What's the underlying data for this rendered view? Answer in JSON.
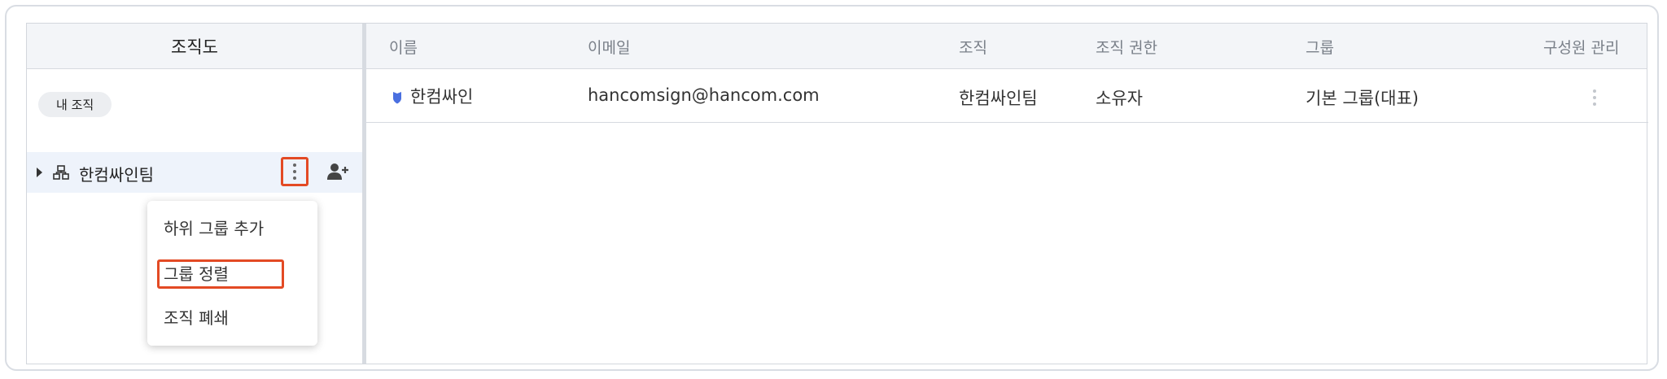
{
  "left_panel": {
    "title": "조직도",
    "my_org_label": "내 조직",
    "tree": {
      "label": "한컴싸인팀"
    },
    "context_menu": {
      "items": [
        {
          "label": "하위 그룹 추가"
        },
        {
          "label": "그룹 정렬"
        },
        {
          "label": "조직 폐쇄"
        }
      ]
    }
  },
  "table": {
    "headers": {
      "name": "이름",
      "email": "이메일",
      "org": "조직",
      "permission": "조직 권한",
      "group": "그룹",
      "manage": "구성원 관리"
    },
    "rows": [
      {
        "name": "한컴싸인",
        "email": "hancomsign@hancom.com",
        "org": "한컴싸인팀",
        "permission": "소유자",
        "group": "기본 그룹(대표)"
      }
    ]
  },
  "colors": {
    "highlight": "#e34a24",
    "header_bg": "#f3f5f8",
    "selected_row": "#eef3fb",
    "shield": "#4a6fe0"
  },
  "icons": {
    "tree_expand": "caret-right-icon",
    "org": "org-chart-icon",
    "more": "kebab-icon",
    "add_member": "add-user-icon",
    "owner": "shield-icon"
  }
}
